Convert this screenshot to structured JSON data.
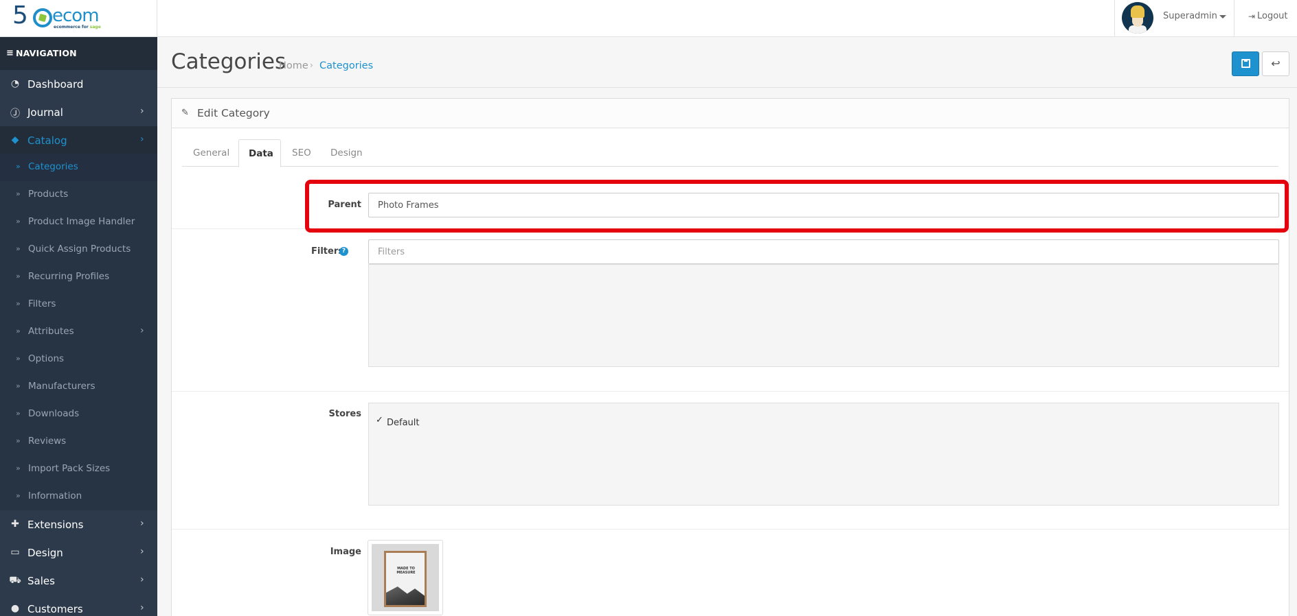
{
  "header": {
    "logo": {
      "number": "5",
      "word": "ecom",
      "tagline_prefix": "ecommerce for ",
      "tagline_brand": "sage"
    },
    "user": {
      "name": "Superadmin"
    },
    "logout_label": "Logout"
  },
  "sidebar": {
    "nav_title": "NAVIGATION",
    "items": [
      {
        "label": "Dashboard",
        "icon": "dashboard-icon"
      },
      {
        "label": "Journal",
        "icon": "journal-icon"
      },
      {
        "label": "Catalog",
        "icon": "tags-icon"
      },
      {
        "label": "Extensions",
        "icon": "puzzle-icon"
      },
      {
        "label": "Design",
        "icon": "desktop-icon"
      },
      {
        "label": "Sales",
        "icon": "cart-icon"
      },
      {
        "label": "Customers",
        "icon": "user-icon"
      }
    ],
    "catalog_sub": [
      {
        "label": "Categories"
      },
      {
        "label": "Products"
      },
      {
        "label": "Product Image Handler"
      },
      {
        "label": "Quick Assign Products"
      },
      {
        "label": "Recurring Profiles"
      },
      {
        "label": "Filters"
      },
      {
        "label": "Attributes"
      },
      {
        "label": "Options"
      },
      {
        "label": "Manufacturers"
      },
      {
        "label": "Downloads"
      },
      {
        "label": "Reviews"
      },
      {
        "label": "Import Pack Sizes"
      },
      {
        "label": "Information"
      }
    ]
  },
  "page": {
    "title": "Categories",
    "breadcrumb": {
      "home": "Home",
      "current": "Categories"
    }
  },
  "panel": {
    "title": "Edit Category",
    "tabs": [
      {
        "label": "General"
      },
      {
        "label": "Data"
      },
      {
        "label": "SEO"
      },
      {
        "label": "Design"
      }
    ],
    "active_tab": "Data",
    "form": {
      "parent": {
        "label": "Parent",
        "value": "Photo Frames"
      },
      "filters": {
        "label": "Filters",
        "placeholder": "Filters"
      },
      "stores": {
        "label": "Stores",
        "options": [
          {
            "label": "Default",
            "checked": true
          }
        ]
      },
      "image": {
        "label": "Image",
        "thumbnail_text": "MADE TO MEASURE"
      }
    }
  },
  "colors": {
    "accent": "#1e91cf",
    "sidebar_bg": "#2d3a4b",
    "highlight": "#e4020c"
  }
}
